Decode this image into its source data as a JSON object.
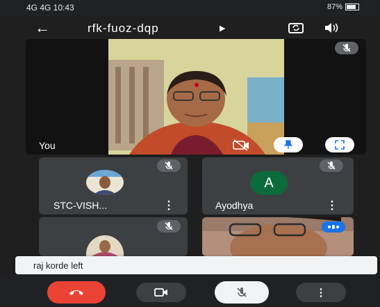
{
  "status_bar": {
    "left_text": "4G 4G 10:43",
    "right_text": "87%"
  },
  "header": {
    "meeting_code": "rfk-fuoz-dqp"
  },
  "self_tile": {
    "label": "You"
  },
  "participants": [
    {
      "name": "STC-VISH...",
      "kebab": "⋮"
    },
    {
      "name": "Ayodhya",
      "avatar_letter": "A",
      "kebab": "⋮"
    }
  ],
  "toast": {
    "message": "raj korde left"
  },
  "colors": {
    "end_call": "#ea4335",
    "avatar_green": "#0b6b3a",
    "tile_bg": "#3c4043",
    "pin_blue": "#1a73e8"
  },
  "icons": [
    "back-arrow-icon",
    "chevron-right-icon",
    "switch-camera-icon",
    "speaker-icon",
    "mic-off-icon",
    "pin-icon",
    "fullscreen-icon",
    "end-call-icon",
    "camera-icon",
    "more-icon"
  ]
}
